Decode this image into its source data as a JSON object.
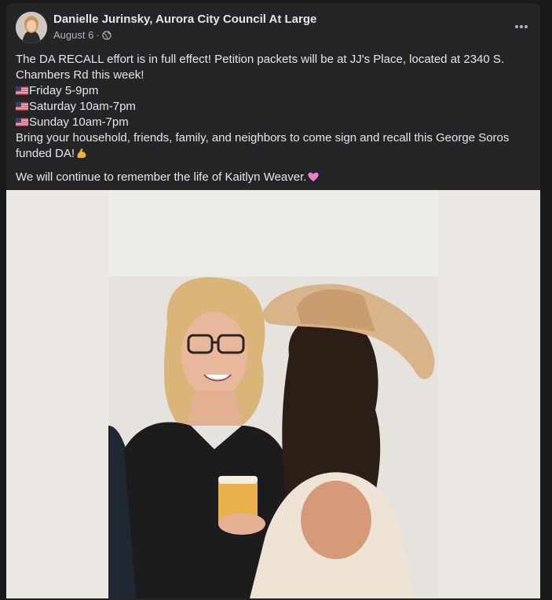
{
  "post": {
    "author": "Danielle Jurinsky, Aurora City Council At Large",
    "date": "August 6",
    "separator": "·",
    "privacy_icon": "globe-icon",
    "more_icon": "more-dots-icon",
    "text": {
      "line1": "The DA RECALL effort is in full effect! Petition packets will be at JJ's Place, located at 2340 S. Chambers Rd this week!",
      "schedule": [
        {
          "flag_icon": "us-flag-icon",
          "label": "Friday 5-9pm"
        },
        {
          "flag_icon": "us-flag-icon",
          "label": "Saturday 10am-7pm"
        },
        {
          "flag_icon": "us-flag-icon",
          "label": "Sunday 10am-7pm"
        }
      ],
      "line5": "Bring your household, friends, family, and neighbors to come sign and recall this George Soros funded DA!",
      "line5_emoji": "flexed-biceps-icon",
      "para2": "We will continue to remember the life of Kaitlyn Weaver.",
      "para2_emoji": "pink-heart-icon"
    },
    "image": {
      "description_icon": "post-photo",
      "colors": {
        "background": "#ebe7e3",
        "photo_bg": "#e6e3df"
      }
    }
  },
  "colors": {
    "page_bg": "#18191a",
    "card_bg": "#242526",
    "text_primary": "#e4e6eb",
    "text_secondary": "#b0b3b8"
  }
}
